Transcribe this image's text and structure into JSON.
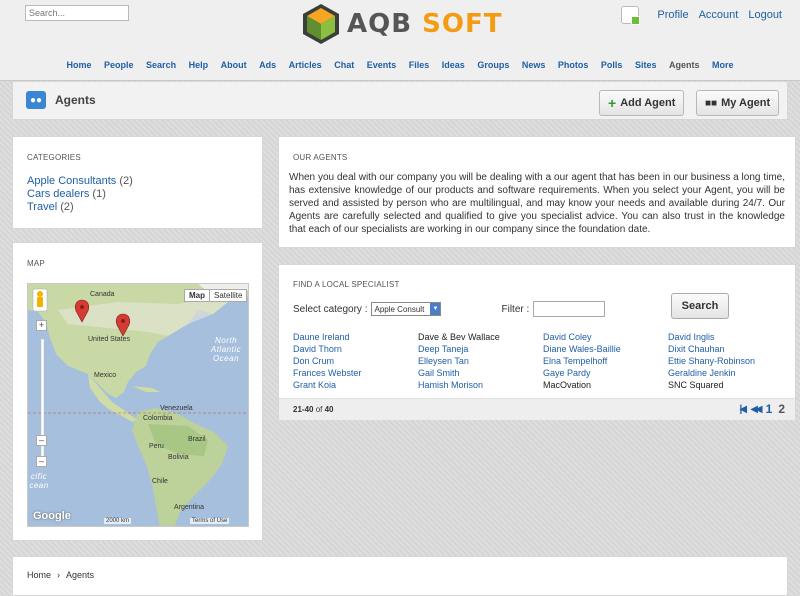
{
  "header": {
    "search_placeholder": "Search...",
    "logo_text_a": "AQB",
    "logo_text_b": "SOFT",
    "user_links": [
      "Profile",
      "Account",
      "Logout"
    ]
  },
  "nav": {
    "items": [
      "Home",
      "People",
      "Search",
      "Help",
      "About",
      "Ads",
      "Articles",
      "Chat",
      "Events",
      "Files",
      "Ideas",
      "Groups",
      "News",
      "Photos",
      "Polls",
      "Sites",
      "Agents",
      "More"
    ],
    "active": "Agents"
  },
  "page": {
    "title": "Agents",
    "add_agent_label": "Add Agent",
    "my_agent_label": "My Agent"
  },
  "categories": {
    "heading": "CATEGORIES",
    "items": [
      {
        "label": "Apple Consultants",
        "count": "(2)"
      },
      {
        "label": "Cars dealers",
        "count": "(1)"
      },
      {
        "label": "Travel",
        "count": "(2)"
      }
    ]
  },
  "map": {
    "heading": "MAP",
    "type_buttons": [
      "Map",
      "Satellite"
    ],
    "labels": {
      "canada": "Canada",
      "us": "United States",
      "mexico": "Mexico",
      "venezuela": "Venezuela",
      "colombia": "Colombia",
      "peru": "Peru",
      "brazil": "Brazil",
      "bolivia": "Bolivia",
      "chile": "Chile",
      "argentina": "Argentina",
      "north_atlantic": "North Atlantic Ocean",
      "pacific": "cific cean"
    },
    "scale": "2000 km",
    "terms": "Terms of Use",
    "google": "Google"
  },
  "our_agents": {
    "heading": "OUR AGENTS",
    "text": "When you deal with our company you will be dealing with a our agent that has been in our business a long time, has extensive knowledge of our products and software requirements. When you select your Agent, you will be served and assisted by person who are multilingual, and may know your needs and available during 24/7. Our Agents are carefully selected and qualified to give you specialist advice. You can also trust in the knowledge that each of our specialists are working in our company since the foundation date."
  },
  "finder": {
    "heading": "FIND A LOCAL SPECIALIST",
    "select_label": "Select category :",
    "select_value": "Apple Consult",
    "filter_label": "Filter :",
    "search_label": "Search",
    "names": [
      [
        "Daune Ireland",
        "Dave & Bev Wallace",
        "David Coley",
        "David Inglis"
      ],
      [
        "David Thorn",
        "Deep Taneja",
        "Diane Wales-Baillie",
        "Dixit Chauhan"
      ],
      [
        "Don Crum",
        "Elleysen Tan",
        "Elna Tempelhoff",
        "Ettie Shany-Robinson"
      ],
      [
        "Frances Webster",
        "Gail Smith",
        "Gaye Pardy",
        "Geraldine Jenkin"
      ],
      [
        "Grant Koia",
        "Hamish Morison",
        "MacOvation",
        "SNC Squared"
      ]
    ],
    "range": "21-40",
    "of_label": "of",
    "total": "40",
    "pages": [
      "1",
      "2"
    ],
    "current_page": "2"
  },
  "breadcrumb": {
    "home": "Home",
    "separator": "›",
    "current": "Agents"
  },
  "colors": {
    "link": "#1f5fa6",
    "accent_orange": "#f39c12",
    "title_icon": "#3a86d6",
    "add_plus": "#2e9c2e"
  }
}
